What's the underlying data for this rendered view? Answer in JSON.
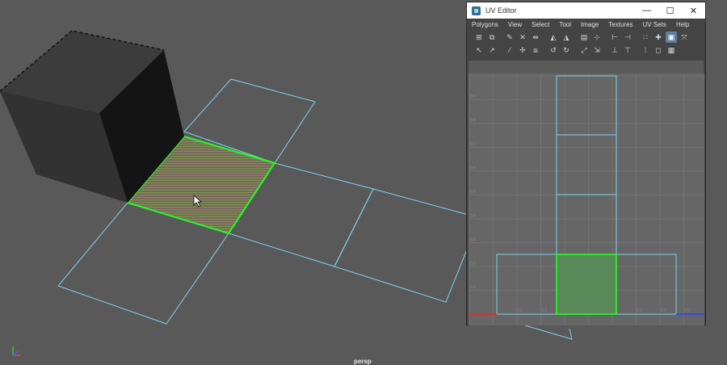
{
  "viewport": {
    "camera_label": "persp"
  },
  "uv_editor": {
    "title": "UV Editor",
    "window_buttons": {
      "minimize": "—",
      "maximize": "☐",
      "close": "✕"
    },
    "menus": [
      "Polygons",
      "View",
      "Select",
      "Tool",
      "Image",
      "Textures",
      "UV Sets",
      "Help"
    ],
    "toolbar_row1": [
      "⊞",
      "⧉",
      "✎",
      "✕",
      "⇹",
      "◭",
      "◮",
      "▤",
      "⊹",
      "⊢",
      "⊣",
      "∷",
      "✚",
      "▣",
      "⤧"
    ],
    "toolbar_row2": [
      "↖",
      "↗",
      "⁄",
      "✢",
      "⧈",
      "↺",
      "↻",
      "⤢",
      "⇲",
      "⊥",
      "⊤",
      "⁞",
      "◻",
      "▦"
    ],
    "tick_labels_y": [
      "0.9",
      "0.8",
      "0.7",
      "0.6",
      "0.5",
      "0.4",
      "0.3",
      "0.2",
      "0.1"
    ],
    "tick_labels_x": [
      "0.2",
      "0.3",
      "0.4",
      "0.5",
      "0.7",
      "0.8",
      "0.9"
    ],
    "colors": {
      "uv_edge": "#7fd3ee",
      "selection": "#22ff22",
      "selected_fill": "#5a8a5a"
    }
  }
}
